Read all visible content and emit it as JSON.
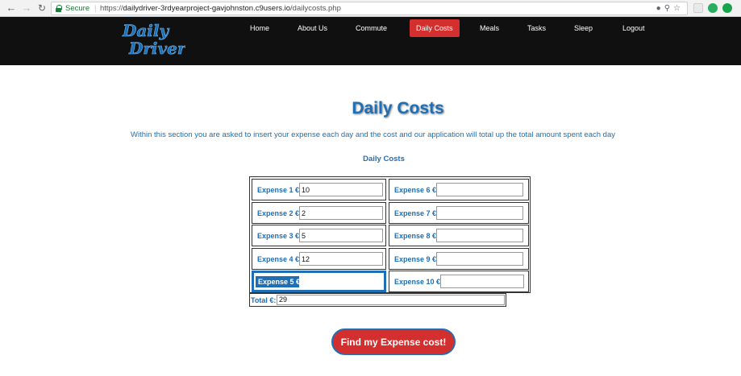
{
  "browser": {
    "secure_label": "Secure",
    "url_scheme": "https://",
    "url_host": "dailydriver-3rdyearproject-gavjohnston.c9users.io",
    "url_path": "/dailycosts.php"
  },
  "site": {
    "logo_text": "Daily Driver",
    "colors": {
      "header_bg": "#101010",
      "accent": "#1e6fb5",
      "active": "#d32f2f"
    },
    "nav": [
      {
        "label": "Home"
      },
      {
        "label": "About Us"
      },
      {
        "label": "Commute"
      },
      {
        "label": "Daily Costs",
        "active": true
      },
      {
        "label": "Meals"
      },
      {
        "label": "Tasks"
      },
      {
        "label": "Sleep"
      },
      {
        "label": "Logout"
      }
    ]
  },
  "page": {
    "title": "Daily Costs",
    "intro": "Within this section you are asked to insert your expense each day and the cost and our application will total up the total amount spent each day",
    "subtitle": "Daily Costs"
  },
  "expenses": [
    {
      "label": "Expense 1 €:",
      "value": "10"
    },
    {
      "label": "Expense 2 €:",
      "value": "2"
    },
    {
      "label": "Expense 3 €:",
      "value": "5"
    },
    {
      "label": "Expense 4 €:",
      "value": "12"
    },
    {
      "label": "Expense 5 €:",
      "value": ""
    },
    {
      "label": "Expense 6 €:",
      "value": ""
    },
    {
      "label": "Expense 7 €:",
      "value": ""
    },
    {
      "label": "Expense 8 €:",
      "value": ""
    },
    {
      "label": "Expense 9 €:",
      "value": ""
    },
    {
      "label": "Expense 10 €:",
      "value": ""
    }
  ],
  "total": {
    "label": "Total €:",
    "value": "29"
  },
  "button": {
    "label": "Find my Expense cost!"
  }
}
